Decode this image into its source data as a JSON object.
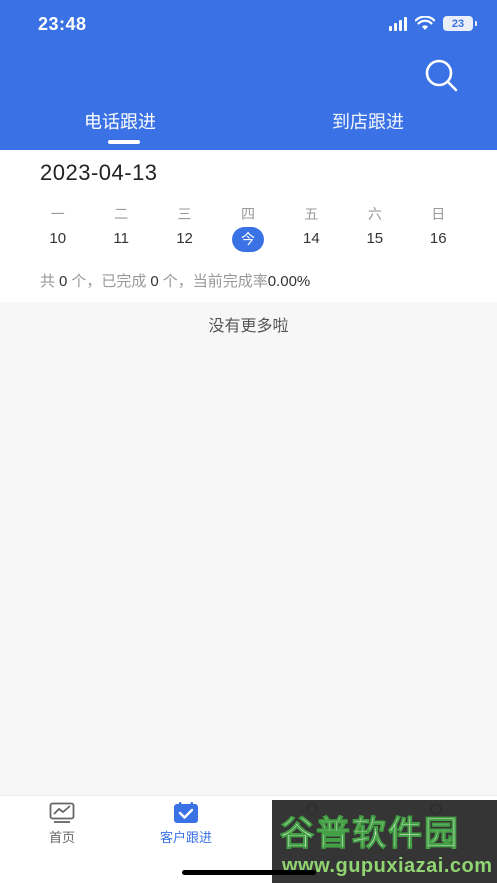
{
  "status_bar": {
    "time": "23:48",
    "battery": "23"
  },
  "header": {
    "tabs": [
      {
        "label": "电话跟进",
        "active": true
      },
      {
        "label": "到店跟进",
        "active": false
      }
    ],
    "search_icon": "search-icon"
  },
  "calendar": {
    "current_date": "2023-04-13",
    "days": [
      {
        "weekday": "一",
        "date": "10"
      },
      {
        "weekday": "二",
        "date": "11"
      },
      {
        "weekday": "三",
        "date": "12"
      },
      {
        "weekday": "四",
        "date": "今",
        "is_today": true
      },
      {
        "weekday": "五",
        "date": "14"
      },
      {
        "weekday": "六",
        "date": "15"
      },
      {
        "weekday": "日",
        "date": "16"
      }
    ]
  },
  "summary": {
    "prefix": "共",
    "total": "0",
    "unit_done": "个，已完成",
    "completed": "0",
    "unit_rate": "个，当前完成率",
    "rate": "0.00%"
  },
  "list": {
    "empty_text": "没有更多啦"
  },
  "tabbar": {
    "items": [
      {
        "label": "首页",
        "icon": "home-chart-icon"
      },
      {
        "label": "客户跟进",
        "icon": "calendar-check-icon",
        "active": true
      }
    ]
  },
  "watermark": {
    "title": "谷普软件园",
    "url": "www.gupuxiazai.com"
  },
  "colors": {
    "primary": "#3a72e6",
    "background": "#f7f7f7"
  }
}
